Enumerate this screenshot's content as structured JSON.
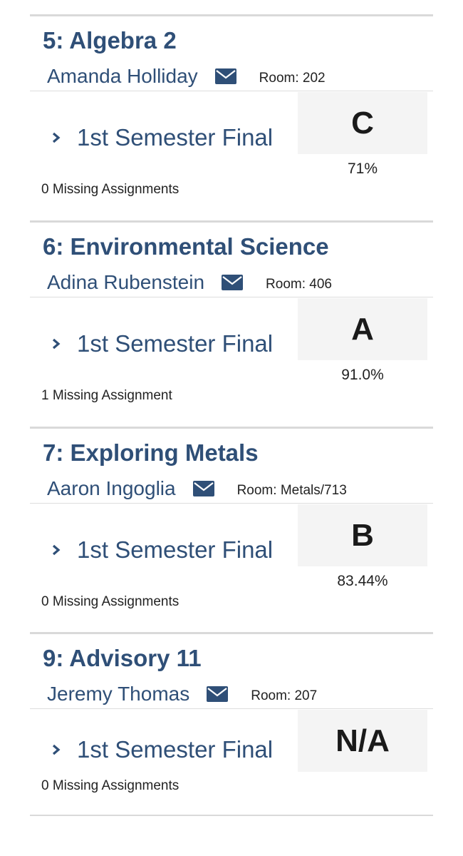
{
  "colors": {
    "accent": "#2f4f77",
    "grade_box_bg": "#f4f4f4",
    "divider": "#d9d9d9"
  },
  "courses": [
    {
      "title": "5: Algebra 2",
      "teacher": "Amanda Holliday",
      "room": "Room: 202",
      "term": "1st Semester Final",
      "grade": "C",
      "percent": "71%",
      "missing": "0 Missing Assignments"
    },
    {
      "title": "6: Environmental Science",
      "teacher": "Adina Rubenstein",
      "room": "Room: 406",
      "term": "1st Semester Final",
      "grade": "A",
      "percent": "91.0%",
      "missing": "1 Missing Assignment"
    },
    {
      "title": "7: Exploring Metals",
      "teacher": "Aaron Ingoglia",
      "room": "Room: Metals/713",
      "term": "1st Semester Final",
      "grade": "B",
      "percent": "83.44%",
      "missing": "0 Missing Assignments"
    },
    {
      "title": "9: Advisory 11",
      "teacher": "Jeremy Thomas",
      "room": "Room: 207",
      "term": "1st Semester Final",
      "grade": "N/A",
      "percent": "",
      "missing": "0 Missing Assignments"
    }
  ],
  "icons": {
    "email": "envelope-icon",
    "expand": "chevron-right-icon"
  }
}
